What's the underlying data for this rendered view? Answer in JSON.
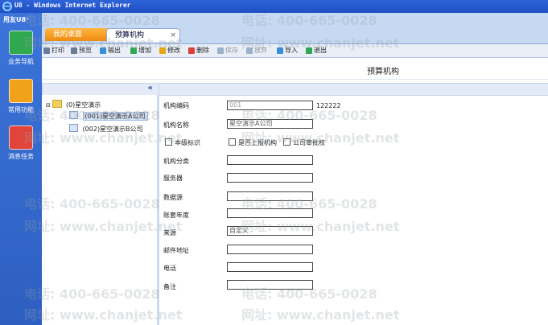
{
  "window": {
    "title": "U8 - Windows Internet Explorer"
  },
  "brand": {
    "name": "用友U8⁺"
  },
  "nav": [
    {
      "label": "业务导航",
      "color": "#2fa84f"
    },
    {
      "label": "常用功能",
      "color": "#f2a11b"
    },
    {
      "label": "消息任务",
      "color": "#e0443a"
    }
  ],
  "tabs": {
    "home": "我的桌面",
    "active": "预算机构",
    "close": "×"
  },
  "toolbar": [
    {
      "label": "打印",
      "color": "#6b7a99",
      "enabled": true
    },
    {
      "label": "预览",
      "color": "#6b7a99",
      "enabled": true
    },
    {
      "label": "输出",
      "color": "#3a8fd8",
      "enabled": true
    },
    {
      "label": "增加",
      "color": "#2fa84f",
      "enabled": true
    },
    {
      "label": "修改",
      "color": "#e8a317",
      "enabled": true
    },
    {
      "label": "删除",
      "color": "#d8403a",
      "enabled": true
    },
    {
      "label": "保存",
      "color": "#9bb0cc",
      "enabled": false
    },
    {
      "label": "放弃",
      "color": "#9bb0cc",
      "enabled": false
    },
    {
      "label": "导入",
      "color": "#3a8fd8",
      "enabled": true
    },
    {
      "label": "退出",
      "color": "#2fa84f",
      "enabled": true
    }
  ],
  "page": {
    "title": "预算机构"
  },
  "tree": {
    "collapse": "«",
    "root": "(0)星空演示",
    "children": [
      "(001)星空演示A公司",
      "(002)星空演示B公司"
    ]
  },
  "form": {
    "code_label": "机构编码",
    "code_value": "001",
    "name_label": "机构名称",
    "name_value": "星空演示A公司",
    "extra_code": "122222",
    "checkbox_1": "本级标识",
    "checkbox_2": "是否上报机构",
    "checkbox_3": "公司审批权",
    "category_label": "机构分类",
    "server_label": "服务器",
    "datasource_label": "数据源",
    "year_label": "账套年度",
    "source_label": "来源",
    "source_value": "自定义",
    "mail_label": "邮件地址",
    "phone_label": "电话",
    "note_label": "备注"
  },
  "watermark": {
    "phone": "电话: 400-665-0028",
    "site": "网址: www.chanjet.net"
  }
}
